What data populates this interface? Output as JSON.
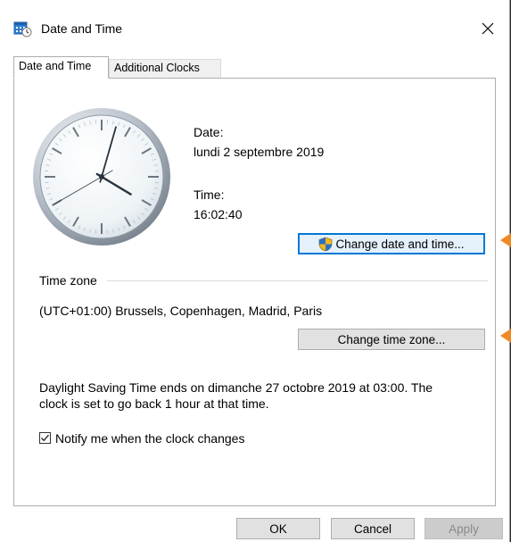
{
  "window": {
    "title": "Date and Time",
    "close_glyph": "✕"
  },
  "tabs": [
    {
      "label": "Date and Time",
      "active": true
    },
    {
      "label": "Additional Clocks",
      "active": false
    }
  ],
  "clock": {
    "icon": "analog-clock",
    "hour": 16,
    "minute": 2,
    "second": 40
  },
  "date": {
    "label": "Date:",
    "value": "lundi 2 septembre 2019"
  },
  "time": {
    "label": "Time:",
    "value": "16:02:40"
  },
  "change_datetime_button": {
    "label": "Change date and time...",
    "icon": "uac-shield-icon"
  },
  "timezone": {
    "group_label": "Time zone",
    "value": "(UTC+01:00) Brussels, Copenhagen, Madrid, Paris",
    "change_button": "Change time zone..."
  },
  "dst": {
    "line1": "Daylight Saving Time ends on dimanche 27 octobre 2019 at 03:00. The",
    "line2": "clock is set to go back 1 hour at that time."
  },
  "notify": {
    "label": "Notify me when the clock changes",
    "checked": true
  },
  "footer": {
    "ok": "OK",
    "cancel": "Cancel",
    "apply": "Apply"
  },
  "colors": {
    "accent": "#0078d7",
    "annotation_arrow": "#f08a24"
  }
}
